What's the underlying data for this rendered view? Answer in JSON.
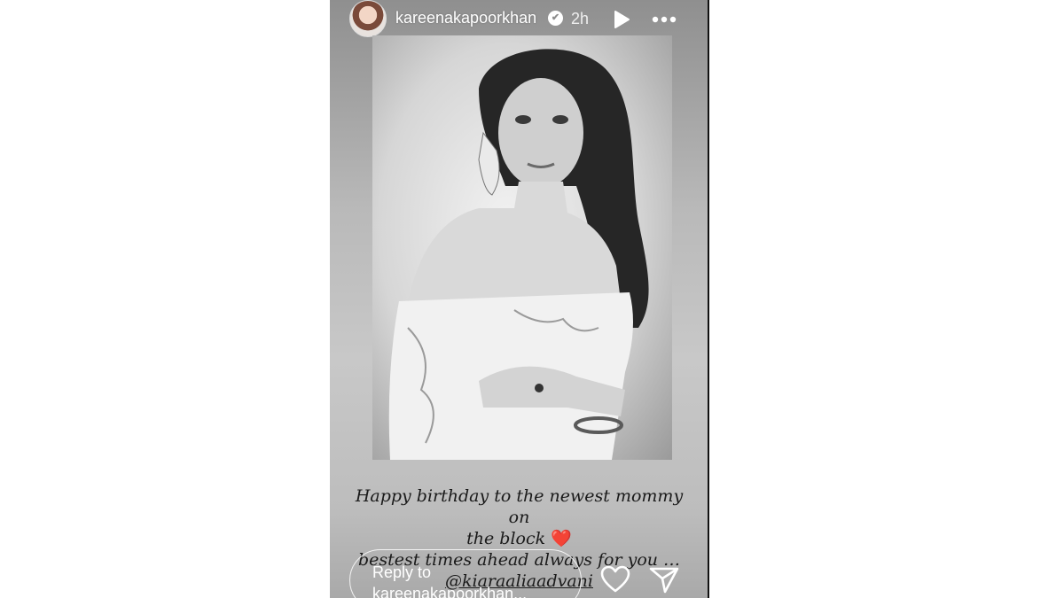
{
  "header": {
    "username": "kareenakapoorkhan",
    "verified_glyph": "✔",
    "time": "2h",
    "icons": [
      "avatar",
      "verified-icon",
      "play-icon",
      "more-icon"
    ]
  },
  "caption": {
    "line1": "Happy birthday to the newest mommy on",
    "line2": "the block",
    "heart": "❤️",
    "line3": "bestest times ahead always for you …",
    "mention": "@kiaraaliaadvani"
  },
  "footer": {
    "reply_placeholder": "Reply to kareenakapoorkhan...",
    "icons": [
      "heart-icon",
      "send-icon"
    ]
  },
  "colors": {
    "story_bg": "#b9b9b9",
    "text_white": "#ffffff",
    "heart_red": "#d4202a"
  }
}
